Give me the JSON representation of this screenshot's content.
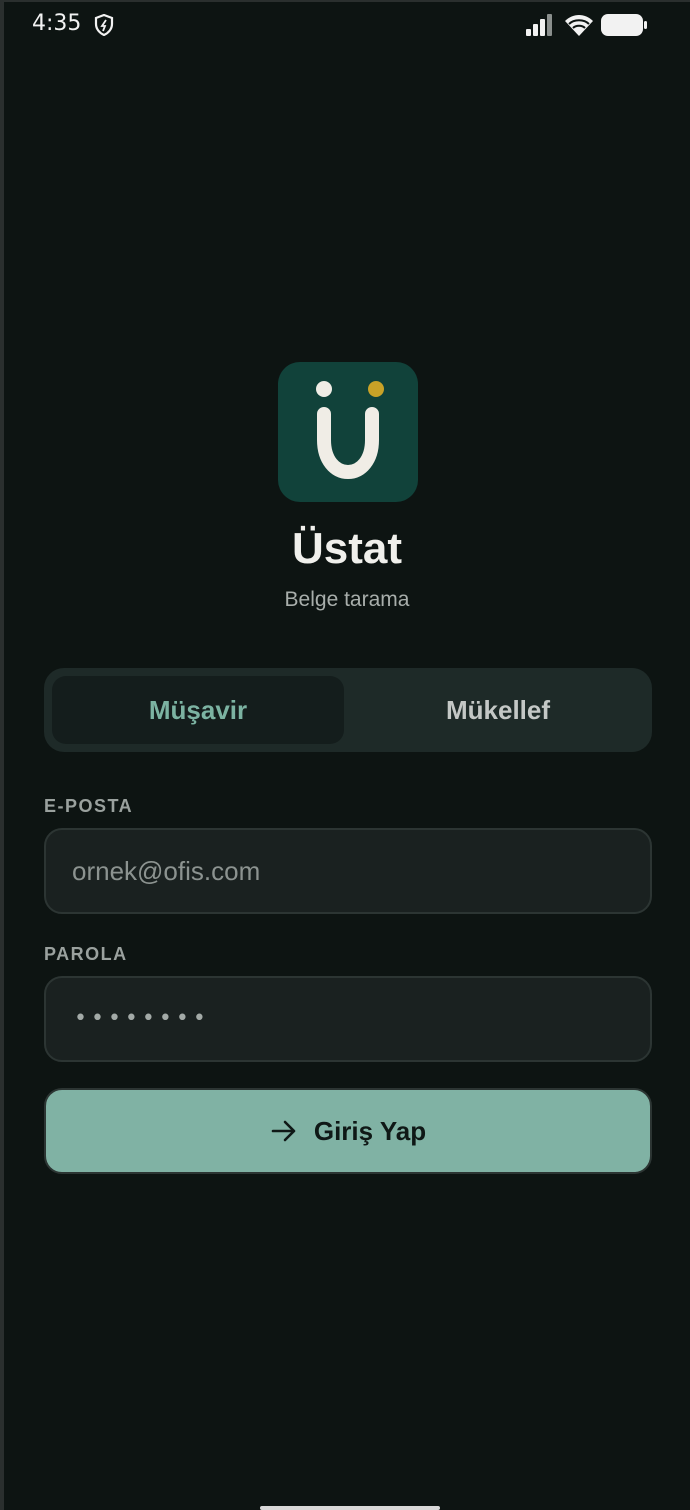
{
  "status_bar": {
    "time": "4:35",
    "icons": [
      "shield-icon",
      "signal-icon",
      "wifi-icon",
      "battery-icon"
    ]
  },
  "app": {
    "logo_icon": "u-logo-icon",
    "title": "Üstat",
    "subtitle": "Belge tarama"
  },
  "role_tabs": {
    "selected": "Müşavir",
    "items": [
      {
        "label": "Müşavir",
        "active": true
      },
      {
        "label": "Mükellef",
        "active": false
      }
    ]
  },
  "form": {
    "email_label": "E-POSTA",
    "email_placeholder": "ornek@ofis.com",
    "password_label": "PAROLA",
    "password_value": "••••••••",
    "submit_label": "Giriş Yap",
    "submit_icon": "arrow-right-icon"
  },
  "colors": {
    "background": "#0d1412",
    "logo_bg": "#11423a",
    "logo_dot": "#c9a227",
    "accent": "#80b2a4",
    "active_tab_text": "#7cb3a2"
  }
}
